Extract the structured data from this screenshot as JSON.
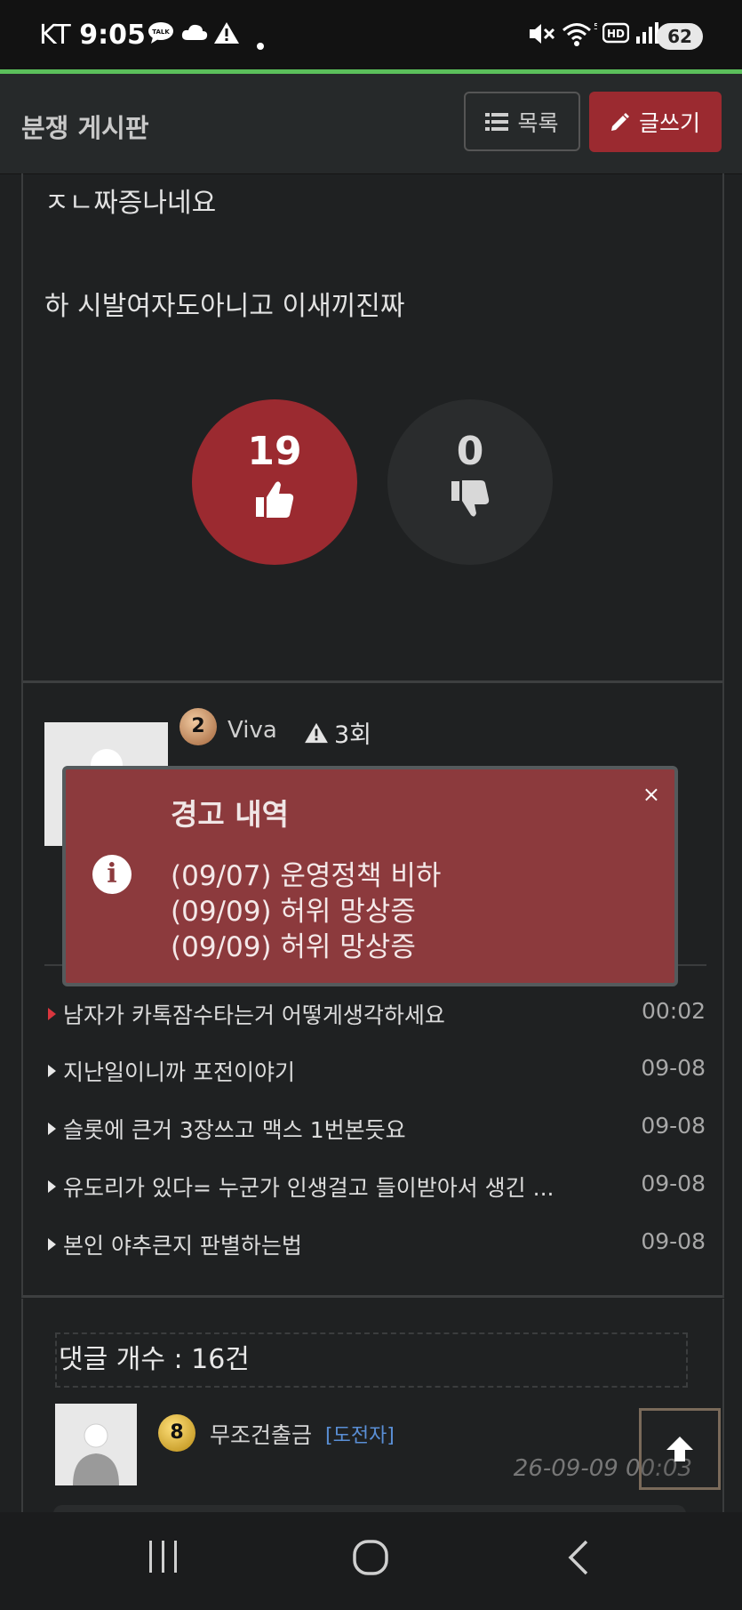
{
  "status_bar": {
    "carrier": "KT",
    "time": "9:05",
    "battery": "62",
    "icons": [
      "talk-icon",
      "cloud-icon",
      "warning-icon",
      "dot-icon",
      "mute-icon",
      "wifi-icon",
      "hd-icon",
      "signal-icon"
    ]
  },
  "header": {
    "title": "분쟁 게시판",
    "list_label": "목록",
    "write_label": "글쓰기"
  },
  "post": {
    "line1": "ㅈㄴ짜증나네요",
    "line2": "하 시발여자도아니고 이새끼진짜",
    "upvotes": "19",
    "downvotes": "0"
  },
  "author": {
    "level": "2",
    "name": "Viva",
    "warning_count": "3회"
  },
  "warning_popup": {
    "title": "경고 내역",
    "close": "×",
    "info_glyph": "i",
    "entries": [
      "(09/07) 운영정책 비하",
      "(09/09) 허위 망상증",
      "(09/09) 허위 망상증"
    ]
  },
  "related_posts": [
    {
      "title": "남자가 카톡잠수타는거 어떻게생각하세요",
      "date": "00:02",
      "current": true
    },
    {
      "title": "지난일이니까 포전이야기",
      "date": "09-08",
      "current": false
    },
    {
      "title": "슬롯에 큰거 3장쓰고 맥스 1번본듯요",
      "date": "09-08",
      "current": false
    },
    {
      "title": "유도리가 있다= 누군가 인생걸고 들이받아서 생긴 ...",
      "date": "09-08",
      "current": false
    },
    {
      "title": "본인 야추큰지 판별하는법",
      "date": "09-08",
      "current": false
    }
  ],
  "comments": {
    "count_label": "댓글 개수 : 16건",
    "first": {
      "level": "8",
      "author": "무조건출금",
      "role": "[도전자]",
      "date": "26-09-09 00:03"
    }
  },
  "colors": {
    "accent": "#9b2a30",
    "popup": "#8c3a3d",
    "background": "#1f2122",
    "status_green": "#5bbf5b"
  }
}
